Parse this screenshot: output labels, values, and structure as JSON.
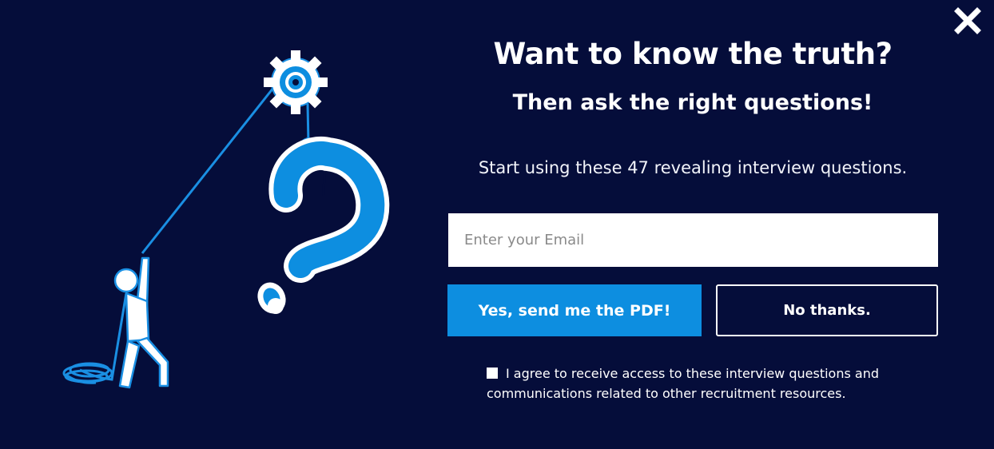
{
  "popup": {
    "headline": "Want to know the truth?",
    "subheadline": "Then ask the right questions!",
    "description": "Start using these 47 revealing interview questions.",
    "email_placeholder": "Enter your Email",
    "primary_button": "Yes, send me the PDF!",
    "secondary_button": "No thanks.",
    "consent_text": "I agree to receive access to these interview questions and communications related to other recruitment resources.",
    "consent_checked": false,
    "close_icon": "close-icon"
  },
  "colors": {
    "background": "#050d3a",
    "accent": "#0d8ee0",
    "text": "#ffffff"
  }
}
